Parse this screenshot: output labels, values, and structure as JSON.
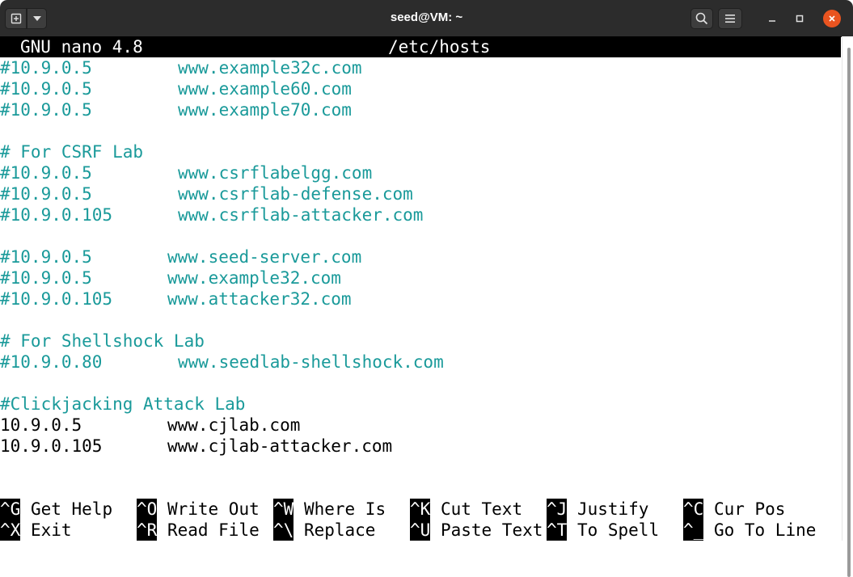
{
  "window": {
    "title": "seed@VM: ~",
    "accent_close": "#e95420"
  },
  "nano": {
    "version": "GNU nano 4.8",
    "filename": "/etc/hosts"
  },
  "lines": [
    {
      "ip": "#10.9.0.5",
      "host": "www.example32c.com",
      "style": "comment",
      "hcol": 220
    },
    {
      "ip": "#10.9.0.5",
      "host": "www.example60.com",
      "style": "comment",
      "hcol": 220
    },
    {
      "ip": "#10.9.0.5",
      "host": "www.example70.com",
      "style": "comment",
      "hcol": 220
    },
    {
      "ip": "",
      "host": "",
      "style": "plain",
      "hcol": 0
    },
    {
      "ip": "# For CSRF Lab",
      "host": "",
      "style": "comment",
      "hcol": 0
    },
    {
      "ip": "#10.9.0.5",
      "host": "www.csrflabelgg.com",
      "style": "comment",
      "hcol": 220
    },
    {
      "ip": "#10.9.0.5",
      "host": "www.csrflab-defense.com",
      "style": "comment",
      "hcol": 220
    },
    {
      "ip": "#10.9.0.105",
      "host": "www.csrflab-attacker.com",
      "style": "comment",
      "hcol": 220
    },
    {
      "ip": "",
      "host": "",
      "style": "plain",
      "hcol": 0
    },
    {
      "ip": "#10.9.0.5",
      "host": "www.seed-server.com",
      "style": "comment",
      "hcol": 207
    },
    {
      "ip": "#10.9.0.5",
      "host": "www.example32.com",
      "style": "comment",
      "hcol": 207
    },
    {
      "ip": "#10.9.0.105",
      "host": "www.attacker32.com",
      "style": "comment",
      "hcol": 207
    },
    {
      "ip": "",
      "host": "",
      "style": "plain",
      "hcol": 0
    },
    {
      "ip": "# For Shellshock Lab",
      "host": "",
      "style": "comment",
      "hcol": 0
    },
    {
      "ip": "#10.9.0.80",
      "host": "www.seedlab-shellshock.com",
      "style": "comment",
      "hcol": 220
    },
    {
      "ip": "",
      "host": "",
      "style": "plain",
      "hcol": 0
    },
    {
      "ip": "#Clickjacking Attack Lab",
      "host": "",
      "style": "comment",
      "hcol": 0
    },
    {
      "ip": "10.9.0.5",
      "host": "www.cjlab.com",
      "style": "plain",
      "hcol": 207
    },
    {
      "ip": "10.9.0.105",
      "host": "www.cjlab-attacker.com",
      "style": "plain",
      "hcol": 207
    }
  ],
  "shortcuts": [
    {
      "key": "^G",
      "label": "Get Help",
      "name": "shortcut-get-help",
      "col": 0,
      "row": 0
    },
    {
      "key": "^X",
      "label": "Exit",
      "name": "shortcut-exit",
      "col": 0,
      "row": 1
    },
    {
      "key": "^O",
      "label": "Write Out",
      "name": "shortcut-write-out",
      "col": 169,
      "row": 0
    },
    {
      "key": "^R",
      "label": "Read File",
      "name": "shortcut-read-file",
      "col": 169,
      "row": 1
    },
    {
      "key": "^W",
      "label": "Where Is",
      "name": "shortcut-where-is",
      "col": 338,
      "row": 0
    },
    {
      "key": "^\\",
      "label": "Replace",
      "name": "shortcut-replace",
      "col": 338,
      "row": 1
    },
    {
      "key": "^K",
      "label": "Cut Text",
      "name": "shortcut-cut-text",
      "col": 507,
      "row": 0
    },
    {
      "key": "^U",
      "label": "Paste Text",
      "name": "shortcut-paste-text",
      "col": 507,
      "row": 1
    },
    {
      "key": "^J",
      "label": "Justify",
      "name": "shortcut-justify",
      "col": 676,
      "row": 0
    },
    {
      "key": "^T",
      "label": "To Spell",
      "name": "shortcut-to-spell",
      "col": 676,
      "row": 1
    },
    {
      "key": "^C",
      "label": "Cur Pos",
      "name": "shortcut-cur-pos",
      "col": 845,
      "row": 0
    },
    {
      "key": "^_",
      "label": "Go To Line",
      "name": "shortcut-go-to-line",
      "col": 845,
      "row": 1
    }
  ]
}
